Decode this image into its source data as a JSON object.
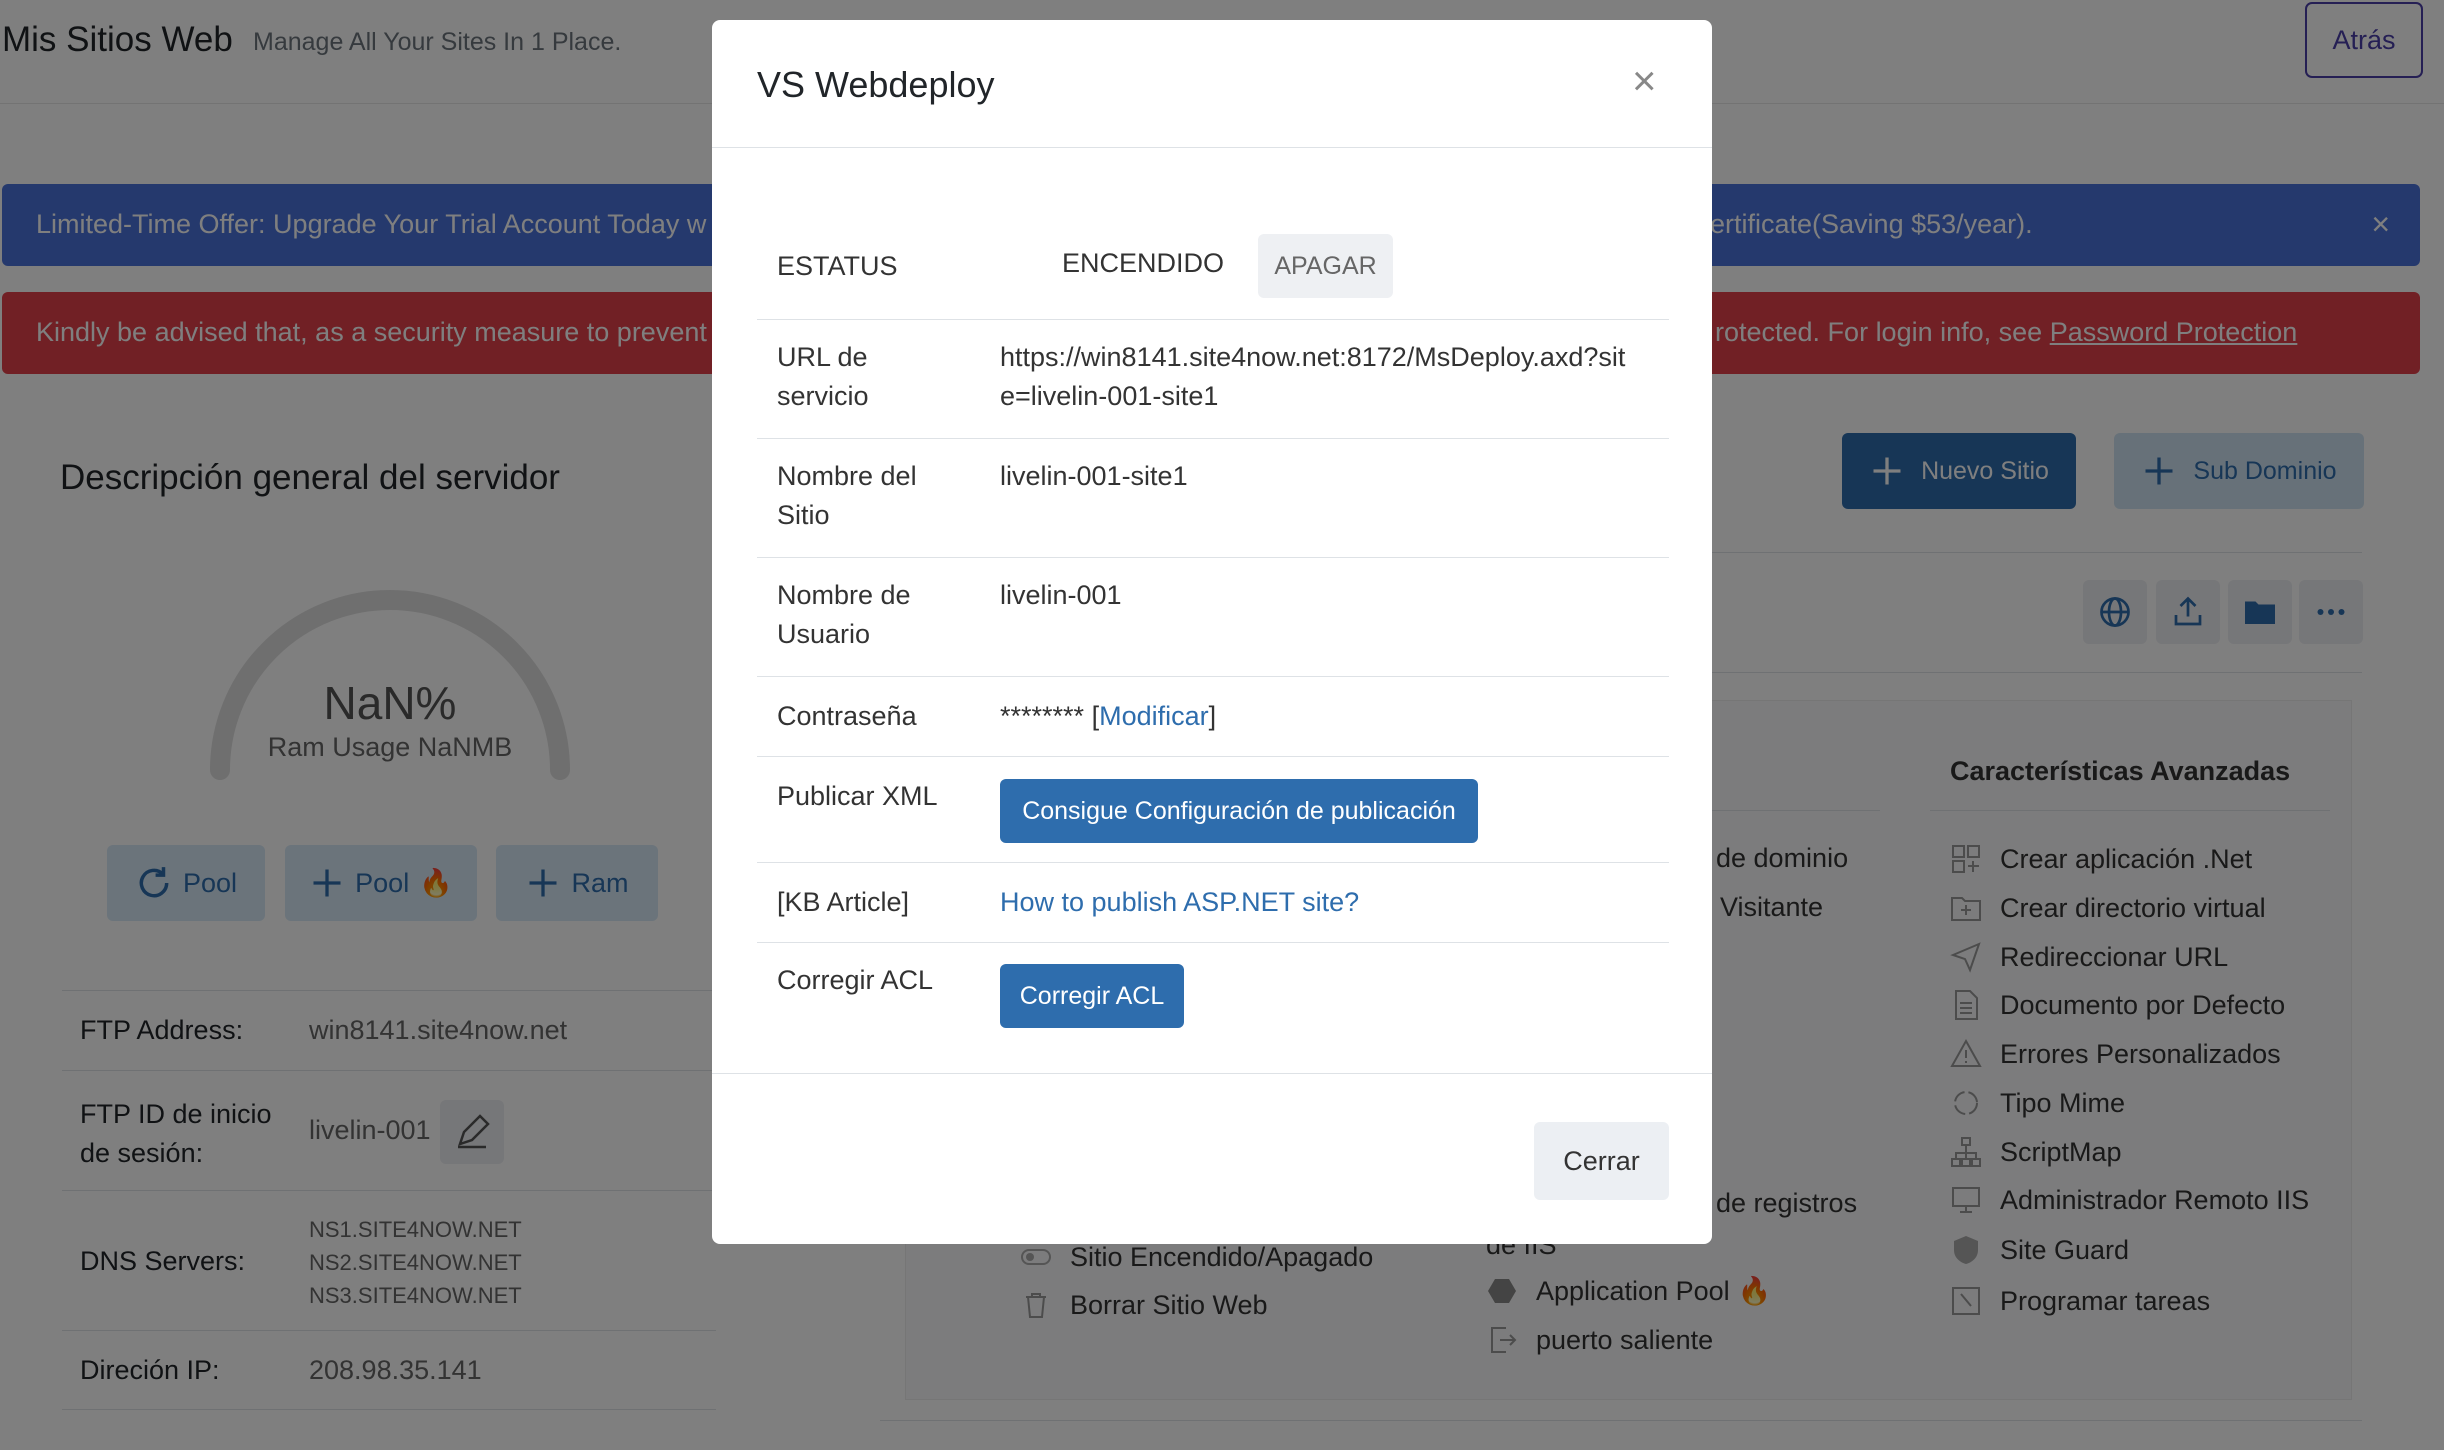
{
  "header": {
    "title": "Mis Sitios Web",
    "subtitle": "Manage All Your Sites In 1 Place.",
    "back_label": "Atrás"
  },
  "banners": {
    "offer_text": "Limited-Time Offer: Upgrade Your Trial Account Today w",
    "offer_text_tail": "ertificate(Saving $53/year).",
    "security_text": "Kindly be advised that, as a security measure to prevent",
    "security_text_tail": "rotected. For login info, see",
    "security_link": "Password Protection"
  },
  "server": {
    "title": "Descripción general del servidor",
    "gauge_value": "NaN%",
    "gauge_label": "Ram Usage NaNMB",
    "gauge_fraction": 0,
    "buttons": {
      "pool_refresh": "Pool",
      "pool_add": "Pool",
      "ram_add": "Ram"
    },
    "info": [
      {
        "label": "FTP Address:",
        "value": "win8141.site4now.net"
      },
      {
        "label_line1": "FTP ID de inicio",
        "label_line2": "de sesión:",
        "value": "livelin-001"
      },
      {
        "label": "DNS Servers:",
        "values": [
          "NS1.SITE4NOW.NET",
          "NS2.SITE4NOW.NET",
          "NS3.SITE4NOW.NET"
        ]
      },
      {
        "label": "Direción IP:",
        "value": "208.98.35.141"
      }
    ]
  },
  "site": {
    "new_site": "Nuevo Sitio",
    "sub_domain": "Sub Dominio"
  },
  "features": {
    "mid_partial": [
      "de dominio",
      "Visitante",
      "de registros",
      "de IIS"
    ],
    "basic": [
      "Sitio Encendido/Apagado",
      "Borrar Sitio Web",
      "Application Pool",
      "puerto saliente"
    ],
    "advanced_title": "Características Avanzadas",
    "advanced": [
      "Crear aplicación .Net",
      "Crear directorio virtual",
      "Redireccionar URL",
      "Documento por Defecto",
      "Errores Personalizados",
      "Tipo Mime",
      "ScriptMap",
      "Administrador Remoto IIS",
      "Site Guard",
      "Programar tareas"
    ]
  },
  "modal": {
    "title": "VS Webdeploy",
    "status_label": "ESTATUS",
    "status_value": "ENCENDIDO",
    "status_btn": "APAGAR",
    "url_label_1": "URL de",
    "url_label_2": "servicio",
    "url_value_1": "https://win8141.site4now.net:8172/MsDeploy.axd?sit",
    "url_value_2": "e=livelin-001-site1",
    "site_label_1": "Nombre del",
    "site_label_2": "Sitio",
    "site_value": "livelin-001-site1",
    "user_label_1": "Nombre de",
    "user_label_2": "Usuario",
    "user_value": "livelin-001",
    "pass_label": "Contraseña",
    "pass_value": "********",
    "pass_link": "Modificar",
    "xml_label": "Publicar XML",
    "xml_btn": "Consigue Configuración de publicación",
    "kb_label": "[KB Article]",
    "kb_link": "How to publish ASP.NET site?",
    "acl_label": "Corregir ACL",
    "acl_btn": "Corregir ACL",
    "close_label": "Cerrar"
  }
}
